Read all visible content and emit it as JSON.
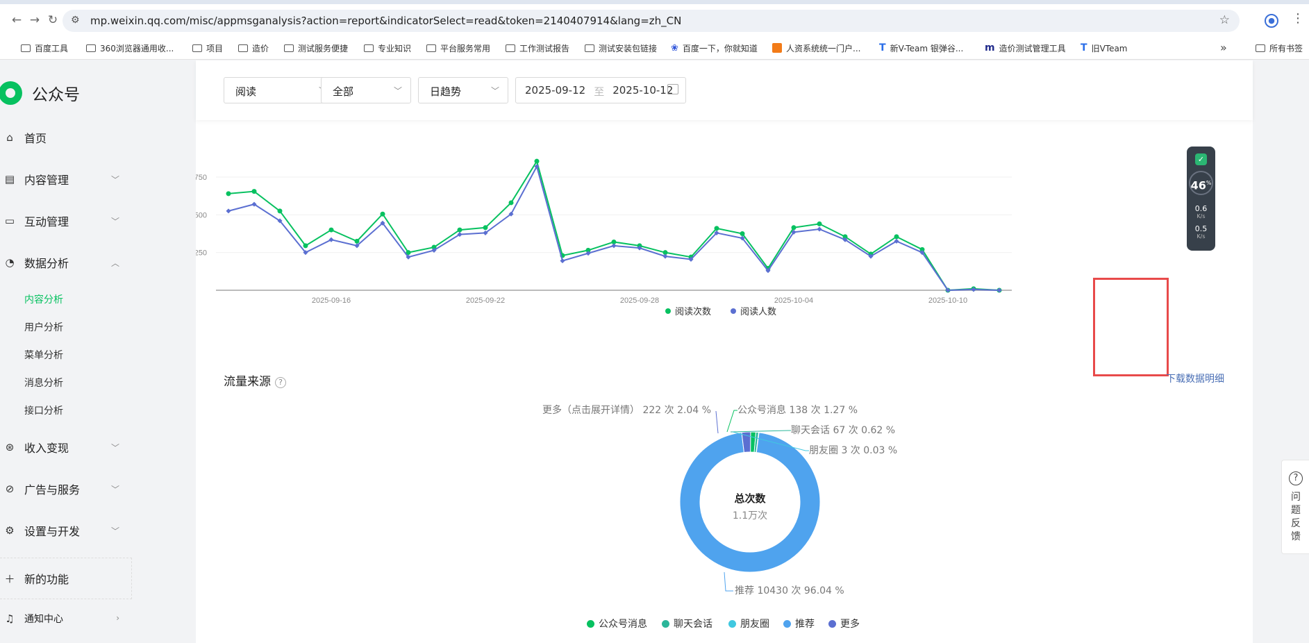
{
  "browser": {
    "url": "mp.weixin.qq.com/misc/appmsganalysis?action=report&indicatorSelect=read&token=2140407914&lang=zh_CN",
    "bookmarks": [
      {
        "label": "百度工具",
        "icon": "folder-icon"
      },
      {
        "label": "360浏览器通用收...",
        "icon": "folder-icon"
      },
      {
        "label": "项目",
        "icon": "folder-icon"
      },
      {
        "label": "造价",
        "icon": "folder-icon"
      },
      {
        "label": "测试服务便捷",
        "icon": "folder-icon"
      },
      {
        "label": "专业知识",
        "icon": "folder-icon"
      },
      {
        "label": "平台服务常用",
        "icon": "folder-icon"
      },
      {
        "label": "工作测试报告",
        "icon": "folder-icon"
      },
      {
        "label": "测试安装包链接",
        "icon": "folder-icon"
      },
      {
        "label": "百度一下，你就知道",
        "icon": "baidu-paw-icon"
      },
      {
        "label": "人资系统统一门户...",
        "icon": "orange-site-icon"
      },
      {
        "label": "新V-Team 银弹谷...",
        "icon": "teambition-icon"
      },
      {
        "label": "造价测试管理工具",
        "icon": "m-site-icon"
      },
      {
        "label": "旧VTeam",
        "icon": "teambition-icon"
      }
    ],
    "all_bookmarks": "所有书签",
    "more_glyph": "»"
  },
  "sidebar": {
    "logo": "公众号",
    "items": [
      {
        "label": "首页",
        "icon": "home-icon"
      },
      {
        "label": "内容管理",
        "icon": "document-icon"
      },
      {
        "label": "互动管理",
        "icon": "chat-icon"
      },
      {
        "label": "数据分析",
        "icon": "pie-chart-icon"
      },
      {
        "label": "收入变现",
        "icon": "coin-icon"
      },
      {
        "label": "广告与服务",
        "icon": "compass-icon"
      },
      {
        "label": "设置与开发",
        "icon": "gear-icon"
      }
    ],
    "sub_items": [
      "内容分析",
      "用户分析",
      "菜单分析",
      "消息分析",
      "接口分析"
    ],
    "new_function": "新的功能",
    "notification": "通知中心"
  },
  "filters": {
    "metric": "阅读",
    "scope": "全部",
    "trend": "日趋势",
    "date_from": "2025-09-12",
    "date_sep": "至",
    "date_to": "2025-10-12"
  },
  "chart_data": [
    {
      "type": "line",
      "x_ticks": [
        "2025-09-16",
        "2025-09-22",
        "2025-09-28",
        "2025-10-04",
        "2025-10-10"
      ],
      "y_ticks": [
        "250",
        "500",
        "750"
      ],
      "x": [
        "2025-09-12",
        "2025-09-13",
        "2025-09-14",
        "2025-09-15",
        "2025-09-16",
        "2025-09-17",
        "2025-09-18",
        "2025-09-19",
        "2025-09-20",
        "2025-09-21",
        "2025-09-22",
        "2025-09-23",
        "2025-09-24",
        "2025-09-25",
        "2025-09-26",
        "2025-09-27",
        "2025-09-28",
        "2025-09-29",
        "2025-09-30",
        "2025-10-01",
        "2025-10-02",
        "2025-10-03",
        "2025-10-04",
        "2025-10-05",
        "2025-10-06",
        "2025-10-07",
        "2025-10-08",
        "2025-10-09",
        "2025-10-10",
        "2025-10-11",
        "2025-10-12"
      ],
      "ylim": [
        0,
        860
      ],
      "series": [
        {
          "name": "阅读次数",
          "color": "#07c160",
          "values": [
            640,
            655,
            525,
            295,
            400,
            325,
            505,
            250,
            285,
            400,
            415,
            580,
            855,
            230,
            265,
            320,
            295,
            250,
            220,
            410,
            375,
            145,
            415,
            440,
            355,
            240,
            355,
            270,
            0,
            10,
            0
          ]
        },
        {
          "name": "阅读人数",
          "color": "#5b6fd1",
          "values": [
            525,
            570,
            460,
            250,
            335,
            295,
            445,
            220,
            265,
            370,
            380,
            505,
            820,
            195,
            245,
            295,
            280,
            225,
            205,
            380,
            345,
            130,
            385,
            405,
            335,
            225,
            325,
            250,
            0,
            5,
            0
          ]
        }
      ]
    },
    {
      "type": "pie",
      "title": "总次数",
      "total": "1.1万次",
      "slices": [
        {
          "name": "公众号消息",
          "label": "公众号消息 138 次 1.27 %",
          "value": 138,
          "percent": 1.27,
          "color": "#07c160"
        },
        {
          "name": "聊天会话",
          "label": "聊天会话 67 次 0.62 %",
          "value": 67,
          "percent": 0.62,
          "color": "#2bb69a"
        },
        {
          "name": "朋友圈",
          "label": "朋友圈 3 次 0.03 %",
          "value": 3,
          "percent": 0.03,
          "color": "#40c8e0"
        },
        {
          "name": "推荐",
          "label": "推荐 10430 次 96.04 %",
          "value": 10430,
          "percent": 96.04,
          "color": "#4fa3ee"
        },
        {
          "name": "更多",
          "label": "更多（点击展开详情） 222 次 2.04 %",
          "value": 222,
          "percent": 2.04,
          "color": "#5b6fd1"
        }
      ]
    }
  ],
  "traffic": {
    "title": "流量来源",
    "help": "?",
    "download": "下载数据明细"
  },
  "widget": {
    "percent": "46",
    "percent_unit": "%",
    "up_speed": "0.6",
    "down_speed": "0.5",
    "speed_unit": "K/s"
  },
  "feedback": {
    "label": "问题反馈",
    "icon_glyph": "?"
  }
}
